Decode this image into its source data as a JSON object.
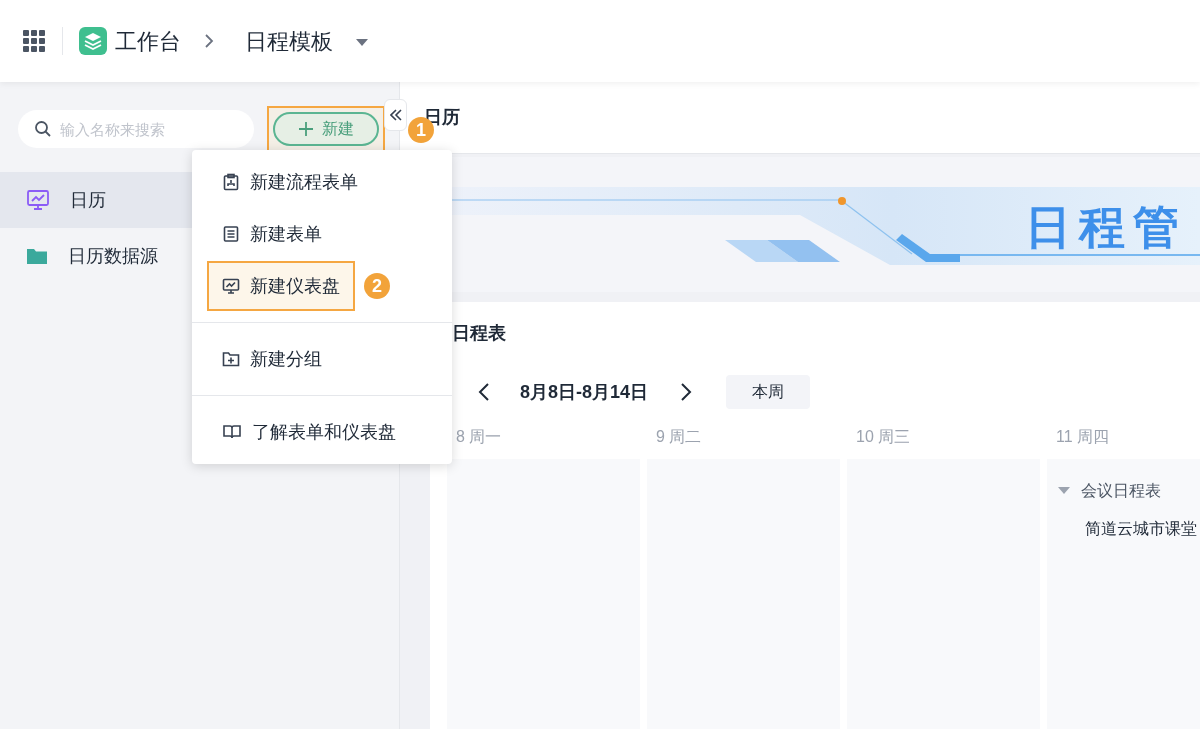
{
  "top_bar": {
    "app_name": "工作台",
    "page_title": "日程模板"
  },
  "sidebar": {
    "search": {
      "placeholder": "输入名称来搜索"
    },
    "new_button": {
      "label": "新建",
      "highlighted": true,
      "badge": "1"
    },
    "items": [
      {
        "label": "日历",
        "kind": "dashboard",
        "selected": true
      },
      {
        "label": "日历数据源",
        "kind": "folder",
        "selected": false
      }
    ]
  },
  "dropdown_menu": {
    "groups": [
      [
        {
          "label": "新建流程表单",
          "kind": "flow-form",
          "highlighted": false
        },
        {
          "label": "新建表单",
          "kind": "form",
          "highlighted": false
        },
        {
          "label": "新建仪表盘",
          "kind": "dashboard",
          "highlighted": true,
          "badge": "2"
        }
      ],
      [
        {
          "label": "新建分组",
          "kind": "group",
          "highlighted": false
        }
      ],
      [
        {
          "label": "了解表单和仪表盘",
          "kind": "help",
          "highlighted": false
        }
      ]
    ]
  },
  "main": {
    "title": "日历",
    "banner": {
      "title": "日程管"
    },
    "schedule": {
      "title": "日程表",
      "range": "8月8日-8月14日",
      "today_button": "本周",
      "days": [
        {
          "label": "8 周一"
        },
        {
          "label": "9 周二"
        },
        {
          "label": "10 周三"
        },
        {
          "label": "11 周四",
          "events": [
            {
              "group": "会议日程表",
              "expanded": true,
              "items": [
                "简道云城市课堂"
              ]
            }
          ]
        }
      ]
    }
  }
}
